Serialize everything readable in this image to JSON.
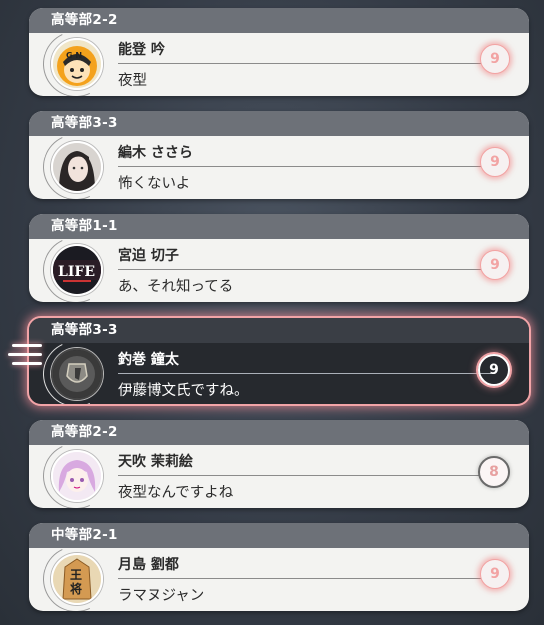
{
  "contacts": [
    {
      "group": "高等部2-2",
      "name": "能登 吟",
      "message": "夜型",
      "badge": "9",
      "avatar_icon": "gn-badge-avatar"
    },
    {
      "group": "高等部3-3",
      "name": "編木 ささら",
      "message": "怖くないよ",
      "badge": "9",
      "avatar_icon": "girl-portrait-avatar"
    },
    {
      "group": "高等部1-1",
      "name": "宮迫 切子",
      "message": "あ、それ知ってる",
      "badge": "9",
      "avatar_icon": "life-logo-avatar"
    },
    {
      "group": "高等部3-3",
      "name": "釣巻 鐘太",
      "message": "伊藤博文氏ですね。",
      "badge": "9",
      "avatar_icon": "crest-emblem-avatar"
    },
    {
      "group": "高等部2-2",
      "name": "天吹 茉莉絵",
      "message": "夜型なんですよね",
      "badge": "8",
      "avatar_icon": "anime-girl-avatar"
    },
    {
      "group": "中等部2-1",
      "name": "月島 劉都",
      "message": "ラマヌジャン",
      "badge": "9",
      "avatar_icon": "shogi-king-avatar"
    }
  ],
  "avatar_marks": {
    "life": "LIFE",
    "shogi_top": "王",
    "shogi_bottom": "将"
  },
  "colors": {
    "header": "#6d7178",
    "selected_border": "#f2a4a7",
    "selected_bg": "#26292e",
    "badge_accent": "#f2a3a3"
  }
}
